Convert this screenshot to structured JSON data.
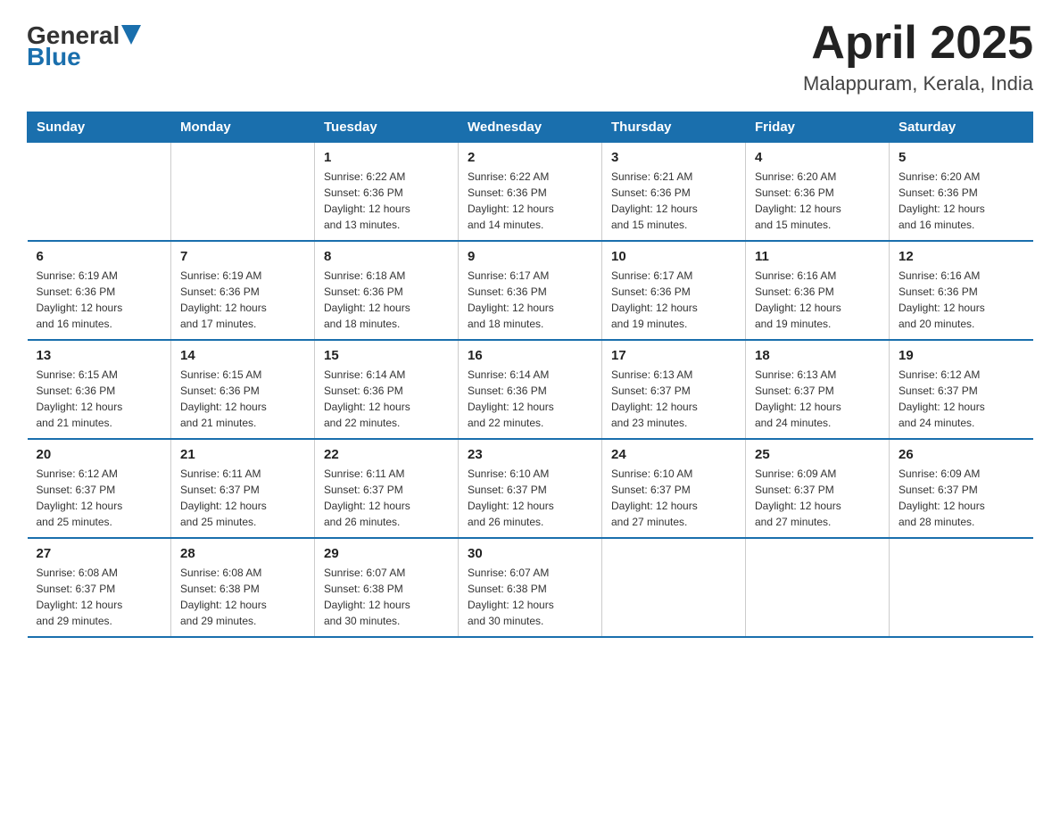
{
  "logo": {
    "general": "General",
    "blue": "Blue"
  },
  "header": {
    "month": "April 2025",
    "location": "Malappuram, Kerala, India"
  },
  "weekdays": [
    "Sunday",
    "Monday",
    "Tuesday",
    "Wednesday",
    "Thursday",
    "Friday",
    "Saturday"
  ],
  "weeks": [
    [
      {
        "day": "",
        "info": ""
      },
      {
        "day": "",
        "info": ""
      },
      {
        "day": "1",
        "info": "Sunrise: 6:22 AM\nSunset: 6:36 PM\nDaylight: 12 hours\nand 13 minutes."
      },
      {
        "day": "2",
        "info": "Sunrise: 6:22 AM\nSunset: 6:36 PM\nDaylight: 12 hours\nand 14 minutes."
      },
      {
        "day": "3",
        "info": "Sunrise: 6:21 AM\nSunset: 6:36 PM\nDaylight: 12 hours\nand 15 minutes."
      },
      {
        "day": "4",
        "info": "Sunrise: 6:20 AM\nSunset: 6:36 PM\nDaylight: 12 hours\nand 15 minutes."
      },
      {
        "day": "5",
        "info": "Sunrise: 6:20 AM\nSunset: 6:36 PM\nDaylight: 12 hours\nand 16 minutes."
      }
    ],
    [
      {
        "day": "6",
        "info": "Sunrise: 6:19 AM\nSunset: 6:36 PM\nDaylight: 12 hours\nand 16 minutes."
      },
      {
        "day": "7",
        "info": "Sunrise: 6:19 AM\nSunset: 6:36 PM\nDaylight: 12 hours\nand 17 minutes."
      },
      {
        "day": "8",
        "info": "Sunrise: 6:18 AM\nSunset: 6:36 PM\nDaylight: 12 hours\nand 18 minutes."
      },
      {
        "day": "9",
        "info": "Sunrise: 6:17 AM\nSunset: 6:36 PM\nDaylight: 12 hours\nand 18 minutes."
      },
      {
        "day": "10",
        "info": "Sunrise: 6:17 AM\nSunset: 6:36 PM\nDaylight: 12 hours\nand 19 minutes."
      },
      {
        "day": "11",
        "info": "Sunrise: 6:16 AM\nSunset: 6:36 PM\nDaylight: 12 hours\nand 19 minutes."
      },
      {
        "day": "12",
        "info": "Sunrise: 6:16 AM\nSunset: 6:36 PM\nDaylight: 12 hours\nand 20 minutes."
      }
    ],
    [
      {
        "day": "13",
        "info": "Sunrise: 6:15 AM\nSunset: 6:36 PM\nDaylight: 12 hours\nand 21 minutes."
      },
      {
        "day": "14",
        "info": "Sunrise: 6:15 AM\nSunset: 6:36 PM\nDaylight: 12 hours\nand 21 minutes."
      },
      {
        "day": "15",
        "info": "Sunrise: 6:14 AM\nSunset: 6:36 PM\nDaylight: 12 hours\nand 22 minutes."
      },
      {
        "day": "16",
        "info": "Sunrise: 6:14 AM\nSunset: 6:36 PM\nDaylight: 12 hours\nand 22 minutes."
      },
      {
        "day": "17",
        "info": "Sunrise: 6:13 AM\nSunset: 6:37 PM\nDaylight: 12 hours\nand 23 minutes."
      },
      {
        "day": "18",
        "info": "Sunrise: 6:13 AM\nSunset: 6:37 PM\nDaylight: 12 hours\nand 24 minutes."
      },
      {
        "day": "19",
        "info": "Sunrise: 6:12 AM\nSunset: 6:37 PM\nDaylight: 12 hours\nand 24 minutes."
      }
    ],
    [
      {
        "day": "20",
        "info": "Sunrise: 6:12 AM\nSunset: 6:37 PM\nDaylight: 12 hours\nand 25 minutes."
      },
      {
        "day": "21",
        "info": "Sunrise: 6:11 AM\nSunset: 6:37 PM\nDaylight: 12 hours\nand 25 minutes."
      },
      {
        "day": "22",
        "info": "Sunrise: 6:11 AM\nSunset: 6:37 PM\nDaylight: 12 hours\nand 26 minutes."
      },
      {
        "day": "23",
        "info": "Sunrise: 6:10 AM\nSunset: 6:37 PM\nDaylight: 12 hours\nand 26 minutes."
      },
      {
        "day": "24",
        "info": "Sunrise: 6:10 AM\nSunset: 6:37 PM\nDaylight: 12 hours\nand 27 minutes."
      },
      {
        "day": "25",
        "info": "Sunrise: 6:09 AM\nSunset: 6:37 PM\nDaylight: 12 hours\nand 27 minutes."
      },
      {
        "day": "26",
        "info": "Sunrise: 6:09 AM\nSunset: 6:37 PM\nDaylight: 12 hours\nand 28 minutes."
      }
    ],
    [
      {
        "day": "27",
        "info": "Sunrise: 6:08 AM\nSunset: 6:37 PM\nDaylight: 12 hours\nand 29 minutes."
      },
      {
        "day": "28",
        "info": "Sunrise: 6:08 AM\nSunset: 6:38 PM\nDaylight: 12 hours\nand 29 minutes."
      },
      {
        "day": "29",
        "info": "Sunrise: 6:07 AM\nSunset: 6:38 PM\nDaylight: 12 hours\nand 30 minutes."
      },
      {
        "day": "30",
        "info": "Sunrise: 6:07 AM\nSunset: 6:38 PM\nDaylight: 12 hours\nand 30 minutes."
      },
      {
        "day": "",
        "info": ""
      },
      {
        "day": "",
        "info": ""
      },
      {
        "day": "",
        "info": ""
      }
    ]
  ]
}
